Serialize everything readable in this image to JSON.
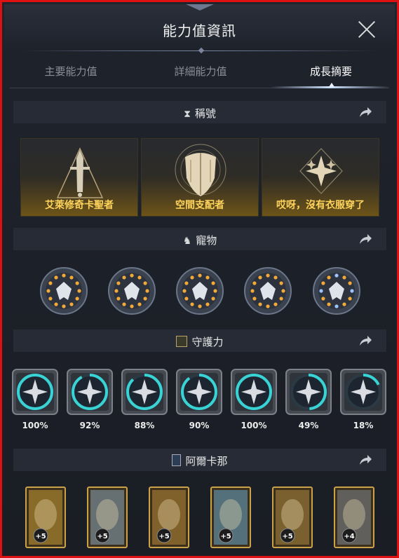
{
  "window": {
    "title": "能力值資訊"
  },
  "tabs": [
    {
      "label": "主要能力值",
      "active": false
    },
    {
      "label": "詳細能力值",
      "active": false
    },
    {
      "label": "成長摘要",
      "active": true
    }
  ],
  "sections": {
    "titles": {
      "label": "稱號",
      "icon": "hourglass-icon",
      "items": [
        {
          "label": "艾萊修奇卡聖者",
          "icon": "sword-triangle-emblem-icon"
        },
        {
          "label": "空間支配者",
          "icon": "shield-emblem-icon"
        },
        {
          "label": "哎呀，沒有衣服穿了",
          "icon": "sparkle-emblem-icon"
        }
      ]
    },
    "pets": {
      "label": "寵物",
      "icon": "horse-icon",
      "items": [
        {
          "icon": "owl-mask-icon",
          "dot_colors": [
            "#f3a938",
            "#f3a938",
            "#f3a938"
          ]
        },
        {
          "icon": "wolf-mask-icon",
          "dot_colors": [
            "#f3a938",
            "#f3a938",
            "#f3a938"
          ]
        },
        {
          "icon": "tree-icon",
          "dot_colors": [
            "#f3a938",
            "#f3a938",
            "#f3a938"
          ]
        },
        {
          "icon": "sun-eye-icon",
          "dot_colors": [
            "#f3a938",
            "#f3a938",
            "#f3a938"
          ]
        },
        {
          "icon": "star-flower-icon",
          "dot_colors": [
            "#9fc3ff",
            "#f3a938",
            "#f3a938"
          ]
        }
      ]
    },
    "guardian": {
      "label": "守護力",
      "icon": "guardian-rune-icon",
      "items": [
        {
          "icon": "winged-sword-icon",
          "percent": "100%",
          "progress": 1.0
        },
        {
          "icon": "feather-blade-icon",
          "percent": "92%",
          "progress": 0.92
        },
        {
          "icon": "crossed-arrows-icon",
          "percent": "88%",
          "progress": 0.88
        },
        {
          "icon": "crossed-swords-icon",
          "percent": "90%",
          "progress": 0.9
        },
        {
          "icon": "compass-star-icon",
          "percent": "100%",
          "progress": 1.0
        },
        {
          "icon": "moon-orb-icon",
          "percent": "49%",
          "progress": 0.49
        },
        {
          "icon": "scales-icon",
          "percent": "18%",
          "progress": 0.18
        }
      ]
    },
    "arcana": {
      "label": "阿爾卡那",
      "icon": "arcana-card-icon",
      "items": [
        {
          "icon": "golden-chalice-card-icon",
          "level": "+5",
          "tint": "#c99a35"
        },
        {
          "icon": "pillars-card-icon",
          "level": "+5",
          "tint": "#8aa4b8"
        },
        {
          "icon": "treasure-pile-card-icon",
          "level": "+5",
          "tint": "#b98a3a"
        },
        {
          "icon": "crystal-orb-card-icon",
          "level": "+5",
          "tint": "#6aa6c8"
        },
        {
          "icon": "ring-portal-card-icon",
          "level": "+5",
          "tint": "#b08940"
        },
        {
          "icon": "stone-throne-card-icon",
          "level": "+4",
          "tint": "#7f8790"
        }
      ]
    }
  },
  "colors": {
    "accent_gold": "#ffd45c",
    "progress_cyan": "#39d3d6",
    "pet_dot_gold": "#f3a938",
    "pet_dot_blue": "#9fc3ff"
  }
}
